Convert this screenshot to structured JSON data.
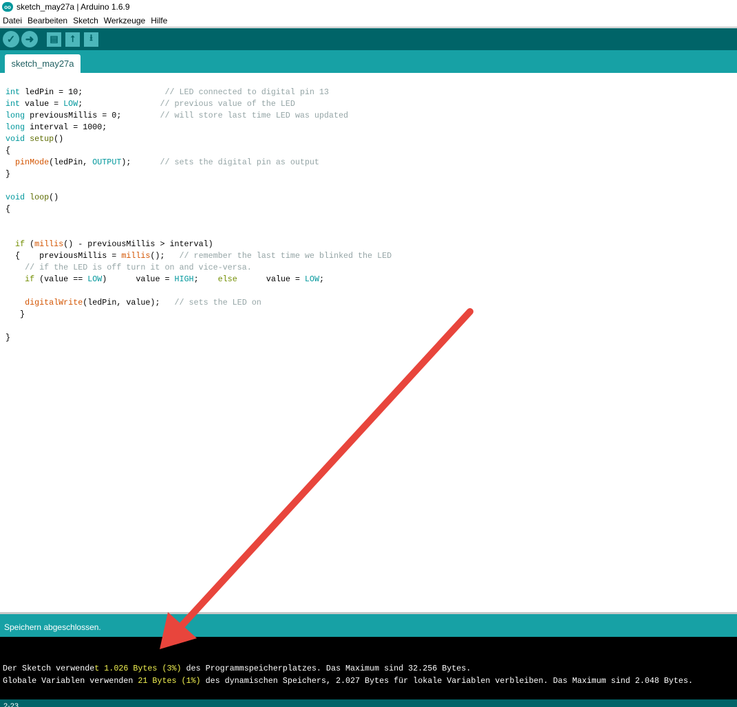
{
  "window": {
    "title": "sketch_may27a | Arduino 1.6.9",
    "logo_text": "oo"
  },
  "menu": [
    "Datei",
    "Bearbeiten",
    "Sketch",
    "Werkzeuge",
    "Hilfe"
  ],
  "toolbar": {
    "verify": "✓",
    "upload": "➜",
    "new": "▤",
    "open": "⭡",
    "save": "⭳"
  },
  "tab": {
    "label": "sketch_may27a"
  },
  "code": [
    [
      [
        "int",
        "kw"
      ],
      " ledPin = 10;                 ",
      [
        "// LED connected to digital pin 13",
        "cm"
      ]
    ],
    [
      [
        "int",
        "kw"
      ],
      " value = ",
      [
        "LOW",
        "cst"
      ],
      ";                ",
      [
        "// previous value of the LED",
        "cm"
      ]
    ],
    [
      [
        "long",
        "kw"
      ],
      " previousMillis = 0;        ",
      [
        "// will store last time LED was updated",
        "cm"
      ]
    ],
    [
      [
        "long",
        "kw"
      ],
      " interval = 1000;"
    ],
    [
      [
        "void",
        "kw"
      ],
      " ",
      [
        "setup",
        "st"
      ],
      "()"
    ],
    [
      "{"
    ],
    [
      "  ",
      [
        "pinMode",
        "fn"
      ],
      "(ledPin, ",
      [
        "OUTPUT",
        "cst"
      ],
      ");      ",
      [
        "// sets the digital pin as output",
        "cm"
      ]
    ],
    [
      "}"
    ],
    [
      ""
    ],
    [
      [
        "void",
        "kw"
      ],
      " ",
      [
        "loop",
        "st"
      ],
      "()"
    ],
    [
      "{"
    ],
    [
      ""
    ],
    [
      ""
    ],
    [
      "  ",
      [
        "if",
        "ctl"
      ],
      " (",
      [
        "millis",
        "fn"
      ],
      "() - previousMillis > interval)"
    ],
    [
      "  {    previousMillis = ",
      [
        "millis",
        "fn"
      ],
      "();   ",
      [
        "// remember the last time we blinked the LED",
        "cm"
      ]
    ],
    [
      "    ",
      [
        "// if the LED is off turn it on and vice-versa.",
        "cm"
      ]
    ],
    [
      "    ",
      [
        "if",
        "ctl"
      ],
      " (value == ",
      [
        "LOW",
        "cst"
      ],
      ")      value = ",
      [
        "HIGH",
        "cst"
      ],
      ";    ",
      [
        "else",
        "ctl"
      ],
      "      value = ",
      [
        "LOW",
        "cst"
      ],
      ";"
    ],
    [
      ""
    ],
    [
      "    ",
      [
        "digitalWrite",
        "fn"
      ],
      "(ledPin, value);   ",
      [
        "// sets the LED on",
        "cm"
      ]
    ],
    [
      "   }"
    ],
    [
      ""
    ],
    [
      "}"
    ]
  ],
  "status": {
    "message": "Speichern abgeschlossen."
  },
  "console": [
    [
      [
        "Der Sketch verwende",
        ""
      ],
      [
        "t 1.026 Bytes (3%)",
        "hl"
      ],
      [
        " des Programmspeicherplatzes. Das Maximum sind 32.256 Bytes.",
        ""
      ]
    ],
    [
      [
        "Globale Variablen verwenden ",
        ""
      ],
      [
        "21 Bytes (1%)",
        "hl"
      ],
      [
        " des dynamischen Speichers, 2.027 Bytes für lokale Variablen verbleiben. Das Maximum sind 2.048 Bytes.",
        ""
      ]
    ]
  ],
  "bottombar": {
    "line": "2-23"
  },
  "annotation": {
    "arrow_color": "#e8453c"
  }
}
